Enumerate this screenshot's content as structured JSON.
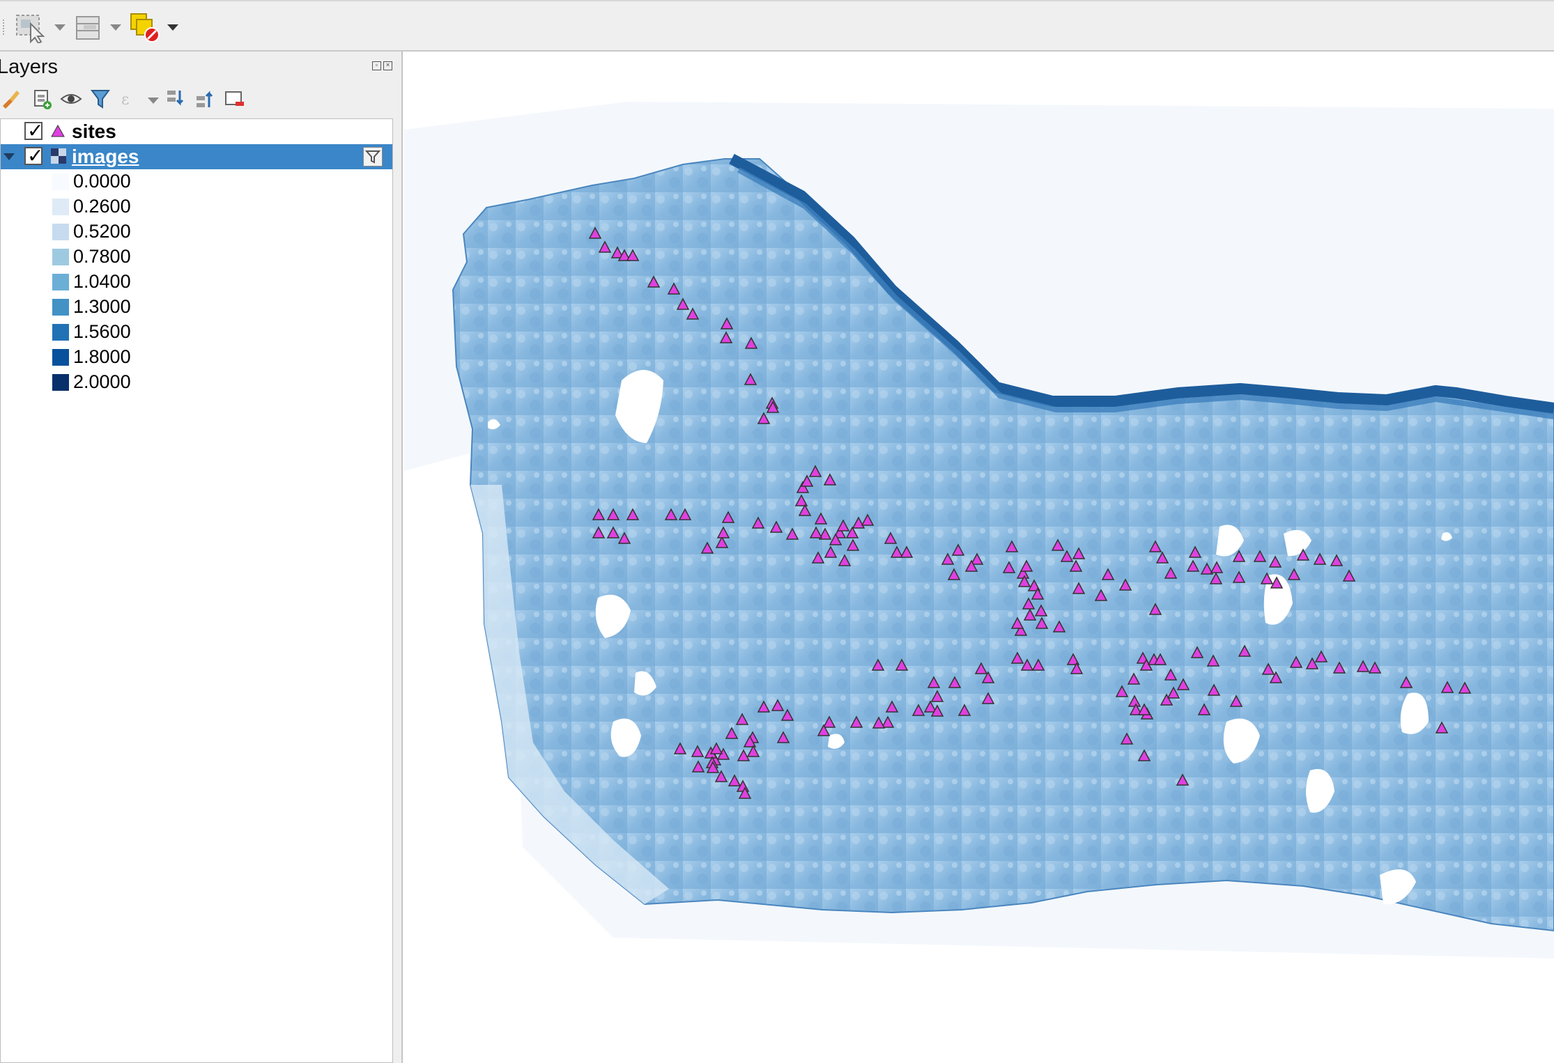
{
  "toolbar": {
    "buttons": [
      {
        "name": "select-features-icon"
      },
      {
        "name": "attribute-table-icon"
      },
      {
        "name": "deselect-features-icon"
      }
    ]
  },
  "layers_panel": {
    "title": "Layers",
    "tools": [
      "style-paint-icon",
      "add-group-icon",
      "visibility-eye-icon",
      "filter-legend-icon",
      "expression-filter-icon",
      "expand-all-icon",
      "collapse-all-icon",
      "remove-layer-icon"
    ],
    "layers": [
      {
        "name": "sites",
        "checked": true,
        "selected": false,
        "icon": "triangle-point-icon"
      },
      {
        "name": "images",
        "checked": true,
        "selected": true,
        "icon": "raster-icon"
      }
    ],
    "legend": [
      {
        "label": "0.0000",
        "color": "#f7fbff"
      },
      {
        "label": "0.2600",
        "color": "#deebf7"
      },
      {
        "label": "0.5200",
        "color": "#c6dbef"
      },
      {
        "label": "0.7800",
        "color": "#9ecae1"
      },
      {
        "label": "1.0400",
        "color": "#6baed6"
      },
      {
        "label": "1.3000",
        "color": "#4292c6"
      },
      {
        "label": "1.5600",
        "color": "#2171b5"
      },
      {
        "label": "1.8000",
        "color": "#08519c"
      },
      {
        "label": "2.0000",
        "color": "#08306b"
      }
    ]
  },
  "colors": {
    "site_marker": "#e040e0",
    "raster_base": "#8fbde3",
    "selection": "#3a86c8"
  }
}
